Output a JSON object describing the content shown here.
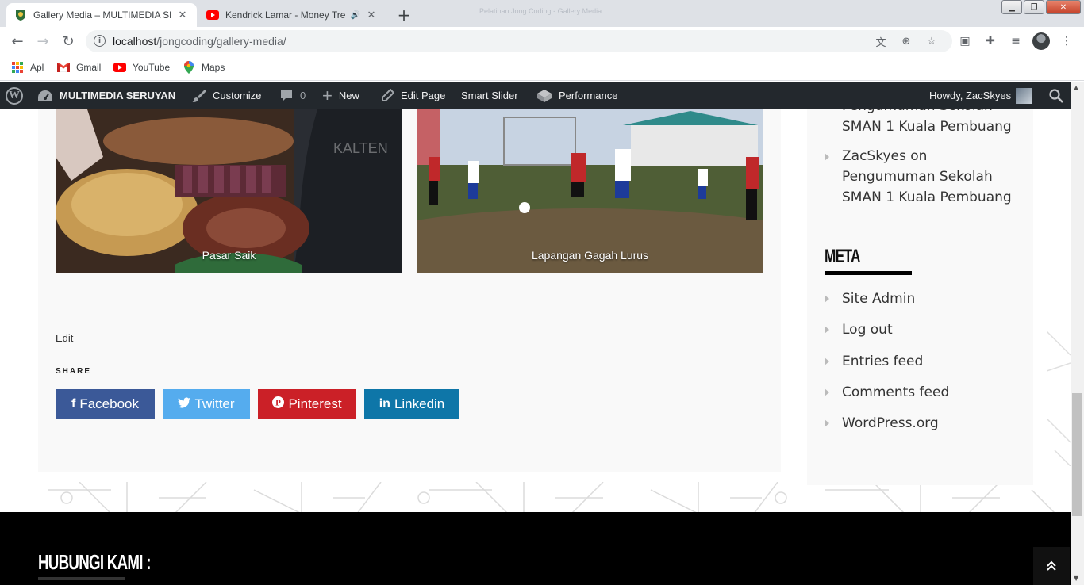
{
  "browser": {
    "tabs": [
      {
        "title": "Gallery Media – MULTIMEDIA SE",
        "active": true
      },
      {
        "title": "Kendrick Lamar - Money Tre",
        "active": false,
        "audio": true
      }
    ],
    "window_title": "Pelatihan Jong Coding - Gallery Media",
    "url_host": "localhost",
    "url_path": "/jongcoding/gallery-media/",
    "bookmarks": [
      "Apl",
      "Gmail",
      "YouTube",
      "Maps"
    ]
  },
  "adminbar": {
    "site_name": "MULTIMEDIA SERUYAN",
    "customize": "Customize",
    "comments_count": "0",
    "new": "New",
    "edit_page": "Edit Page",
    "smart_slider": "Smart Slider",
    "performance": "Performance",
    "howdy": "Howdy, ZacSkyes"
  },
  "gallery": [
    {
      "caption": "Pasar Saik"
    },
    {
      "caption": "Lapangan Gagah Lurus"
    }
  ],
  "article": {
    "edit": "Edit",
    "share_heading": "SHARE",
    "share_buttons": [
      {
        "label": "Facebook",
        "icon": "f",
        "color": "#3b5998"
      },
      {
        "label": "Twitter",
        "icon": "twitter-bird",
        "color": "#55acee"
      },
      {
        "label": "Pinterest",
        "icon": "P",
        "color": "#cb2027"
      },
      {
        "label": "Linkedin",
        "icon": "in",
        "color": "#0e76a8"
      }
    ]
  },
  "sidebar": {
    "recent_comments": [
      {
        "text_partial": "Pengumuman Sekolah",
        "line2": "SMAN 1 Kuala Pembuang"
      },
      {
        "line1": "ZacSkyes on",
        "line2": "Pengumuman Sekolah",
        "line3": "SMAN 1 Kuala Pembuang"
      }
    ],
    "meta_heading": "META",
    "meta_items": [
      "Site Admin",
      "Log out",
      "Entries feed",
      "Comments feed",
      "WordPress.org"
    ]
  },
  "footer": {
    "heading": "HUBUNGI KAMI :"
  }
}
